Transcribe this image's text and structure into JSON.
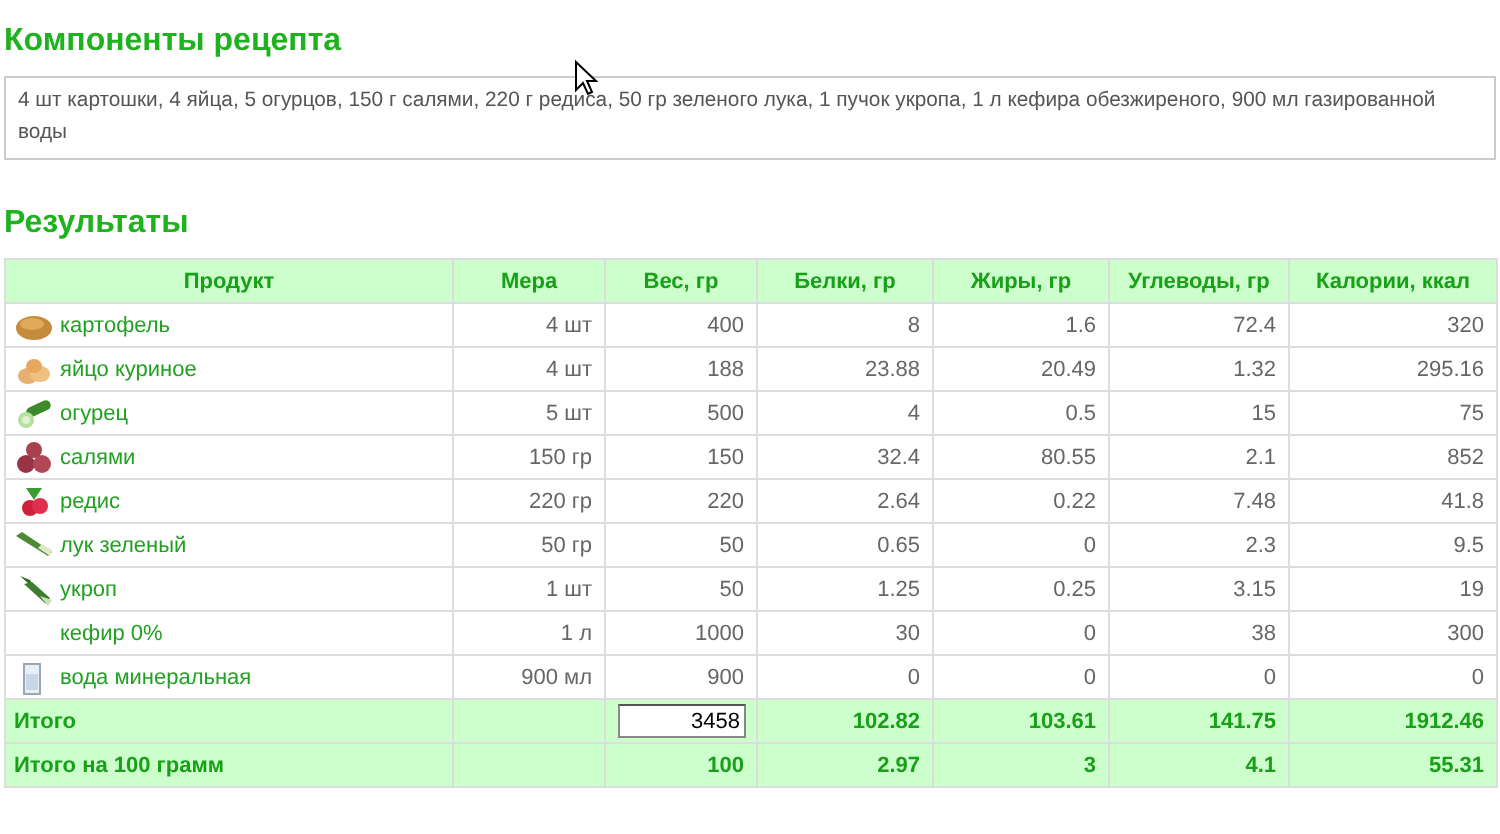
{
  "recipe": {
    "title": "Компоненты рецепта",
    "text": "4 шт картошки, 4 яйца, 5 огурцов, 150 г салями, 220 г редиса, 50 гр зеленого лука, 1 пучок укропа, 1 л кефира обезжиреного, 900 мл газированной воды"
  },
  "results": {
    "title": "Результаты",
    "columns": [
      "Продукт",
      "Мера",
      "Вес, гр",
      "Белки, гр",
      "Жиры, гр",
      "Углеводы, гр",
      "Калории, ккал"
    ],
    "rows": [
      {
        "product": "картофель",
        "measure": "4 шт",
        "weight": "400",
        "protein": "8",
        "fat": "1.6",
        "carbs": "72.4",
        "calories": "320"
      },
      {
        "product": "яйцо куриное",
        "measure": "4 шт",
        "weight": "188",
        "protein": "23.88",
        "fat": "20.49",
        "carbs": "1.32",
        "calories": "295.16"
      },
      {
        "product": "огурец",
        "measure": "5 шт",
        "weight": "500",
        "protein": "4",
        "fat": "0.5",
        "carbs": "15",
        "calories": "75"
      },
      {
        "product": "салями",
        "measure": "150 гр",
        "weight": "150",
        "protein": "32.4",
        "fat": "80.55",
        "carbs": "2.1",
        "calories": "852"
      },
      {
        "product": "редис",
        "measure": "220 гр",
        "weight": "220",
        "protein": "2.64",
        "fat": "0.22",
        "carbs": "7.48",
        "calories": "41.8"
      },
      {
        "product": "лук зеленый",
        "measure": "50 гр",
        "weight": "50",
        "protein": "0.65",
        "fat": "0",
        "carbs": "2.3",
        "calories": "9.5"
      },
      {
        "product": "укроп",
        "measure": "1 шт",
        "weight": "50",
        "protein": "1.25",
        "fat": "0.25",
        "carbs": "3.15",
        "calories": "19"
      },
      {
        "product": "кефир 0%",
        "measure": "1 л",
        "weight": "1000",
        "protein": "30",
        "fat": "0",
        "carbs": "38",
        "calories": "300"
      },
      {
        "product": "вода минеральная",
        "measure": "900 мл",
        "weight": "900",
        "protein": "0",
        "fat": "0",
        "carbs": "0",
        "calories": "0"
      }
    ],
    "totals": [
      {
        "kind": "field",
        "label": "Итого",
        "weight": "3458",
        "protein": "102.82",
        "fat": "103.61",
        "carbs": "141.75",
        "calories": "1912.46"
      },
      {
        "kind": "text",
        "label": "Итого на 100 грамм",
        "weight": "100",
        "protein": "2.97",
        "fat": "3",
        "carbs": "4.1",
        "calories": "55.31"
      }
    ]
  }
}
